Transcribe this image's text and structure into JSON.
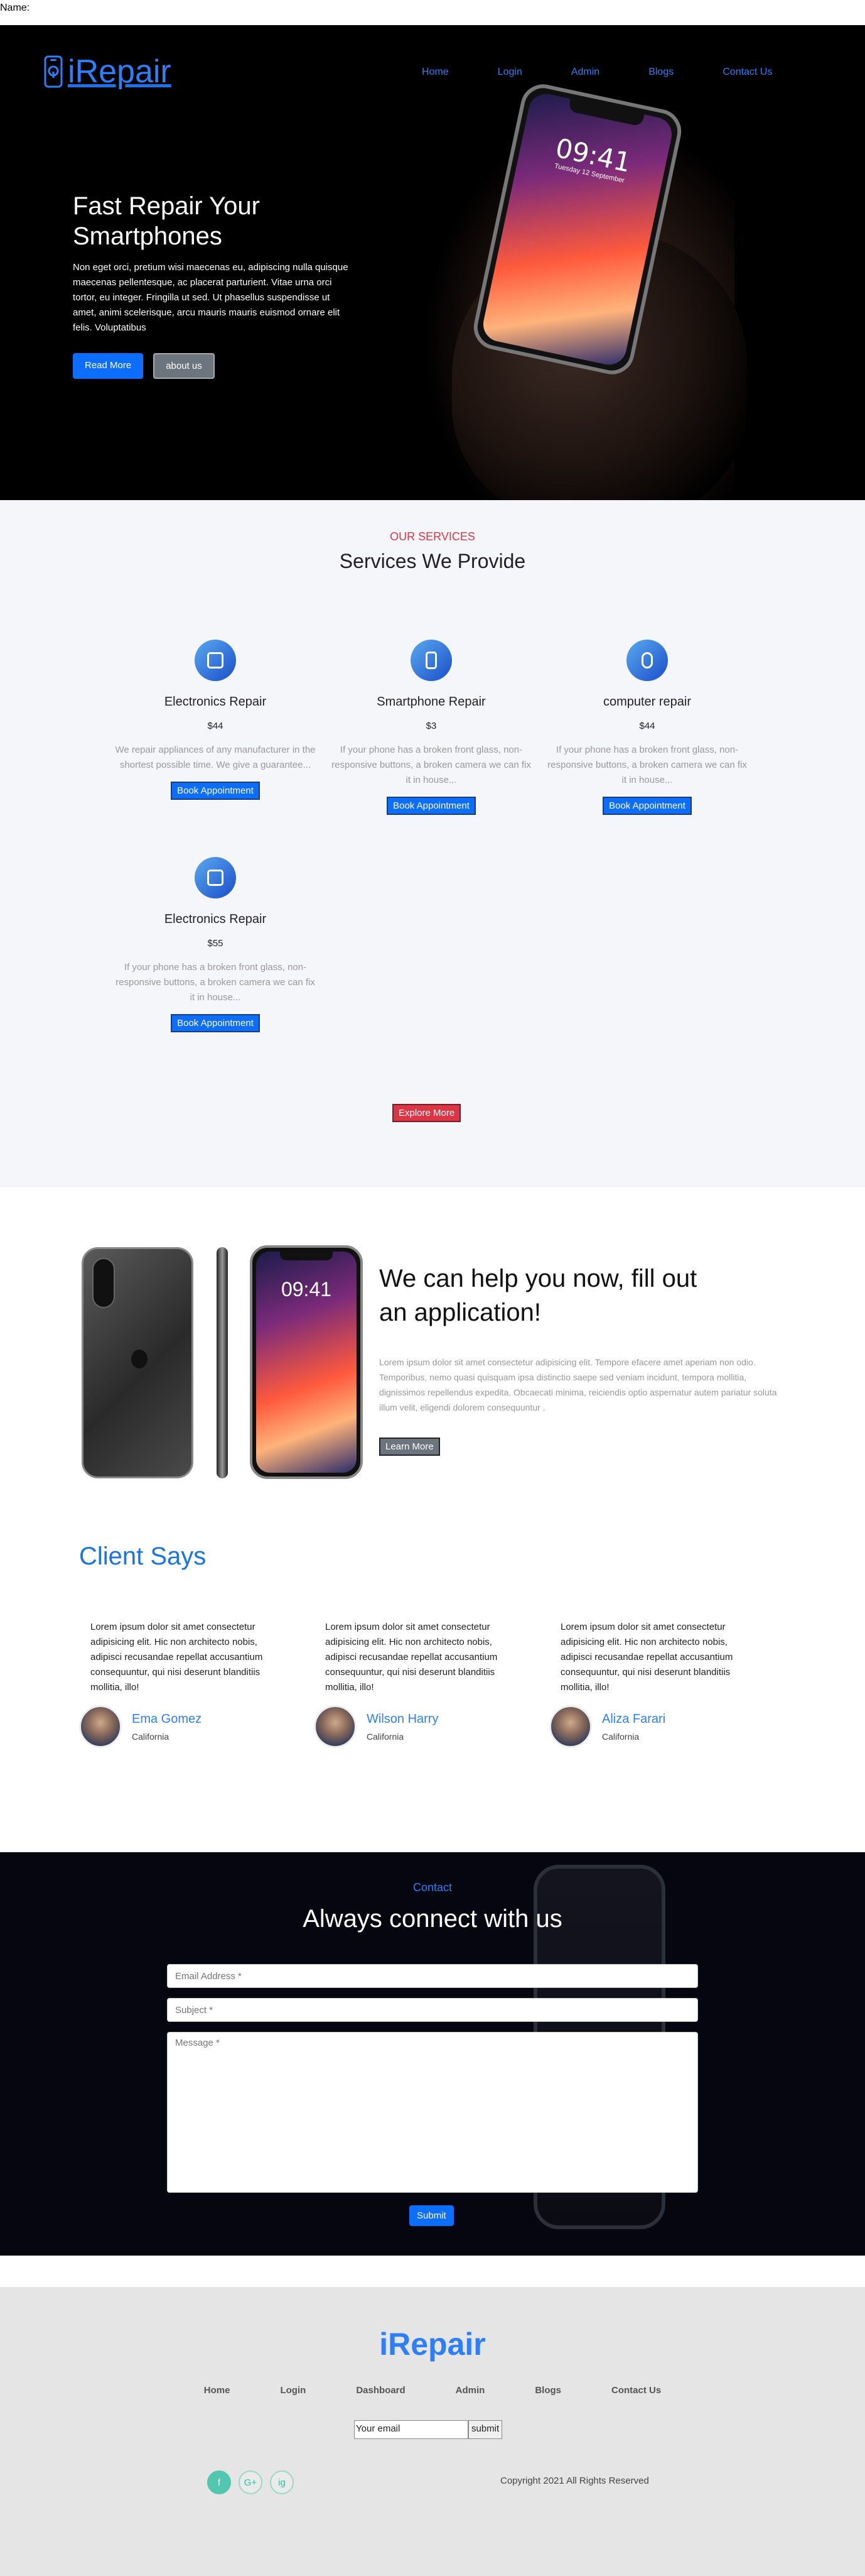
{
  "page": {
    "label": "Name:"
  },
  "header": {
    "brand": "iRepair",
    "nav": [
      "Home",
      "Login",
      "Admin",
      "Blogs",
      "Contact Us"
    ]
  },
  "hero": {
    "title": "Fast Repair Your Smartphones",
    "text": "Non eget orci, pretium wisi maecenas eu, adipiscing nulla quisque maecenas pellentesque, ac placerat parturient. Vitae urna orci tortor, eu integer. Fringilla ut sed. Ut phasellus suspendisse ut amet, animi scelerisque, arcu mauris mauris euismod ornare elit felis. Voluptatibus",
    "read_more": "Read More",
    "about": "about us",
    "phone_time": "09:41",
    "phone_date": "Tuesday 12 September"
  },
  "services": {
    "kicker": "OUR SERVICES",
    "title": "Services We Provide",
    "items": [
      {
        "name": "Electronics Repair",
        "price": "$44",
        "desc": "We repair appliances of any manufacturer in the shortest possible time. We give a guarantee...",
        "button": "Book Appointment"
      },
      {
        "name": "Smartphone Repair",
        "price": "$3",
        "desc": "If your phone has a broken front glass, non-responsive buttons, a broken camera we can fix it in house...",
        "button": "Book Appointment"
      },
      {
        "name": "computer repair",
        "price": "$44",
        "desc": "If your phone has a broken front glass, non-responsive buttons, a broken camera we can fix it in house...",
        "button": "Book Appointment"
      },
      {
        "name": "Electronics Repair",
        "price": "$55",
        "desc": "If your phone has a broken front glass, non-responsive buttons, a broken camera we can fix it in house...",
        "button": "Book Appointment"
      }
    ],
    "explore": "Explore More"
  },
  "help": {
    "title": "We can help you now, fill out an application!",
    "text": "Lorem ipsum dolor sit amet consectetur adipisicing elit. Tempore efacere amet aperiam non odio. Temporibus, nemo quasi quisquam ipsa distinctio saepe sed veniam incidunt, tempora mollitia, dignissimos repellendus expedita. Obcaecati minima, reiciendis optio aspernatur autem pariatur soluta illum velit, eligendi dolorem consequuntur .",
    "button": "Learn More",
    "phone_time": "09:41"
  },
  "clients": {
    "title": "Client Says",
    "items": [
      {
        "text": "Lorem ipsum dolor sit amet consectetur adipisicing elit. Hic non architecto nobis, adipisci recusandae repellat accusantium consequuntur, qui nisi deserunt blanditiis mollitia, illo!",
        "name": "Ema Gomez",
        "place": "California"
      },
      {
        "text": "Lorem ipsum dolor sit amet consectetur adipisicing elit. Hic non architecto nobis, adipisci recusandae repellat accusantium consequuntur, qui nisi deserunt blanditiis mollitia, illo!",
        "name": "Wilson Harry",
        "place": "California"
      },
      {
        "text": "Lorem ipsum dolor sit amet consectetur adipisicing elit. Hic non architecto nobis, adipisci recusandae repellat accusantium consequuntur, qui nisi deserunt blanditiis mollitia, illo!",
        "name": "Aliza Farari",
        "place": "California"
      }
    ]
  },
  "contact": {
    "kicker": "Contact",
    "title": "Always connect with us",
    "email_placeholder": "Email Address *",
    "subject_placeholder": "Subject *",
    "message_placeholder": "Message *",
    "submit": "Submit"
  },
  "footer": {
    "brand": "iRepair",
    "nav": [
      "Home",
      "Login",
      "Dashboard",
      "Admin",
      "Blogs",
      "Contact Us"
    ],
    "email_value": "Your email",
    "subscribe": "submit",
    "social": [
      "f",
      "G+",
      "ig"
    ],
    "copyright": "Copyright 2021 All Rights Reserved"
  }
}
